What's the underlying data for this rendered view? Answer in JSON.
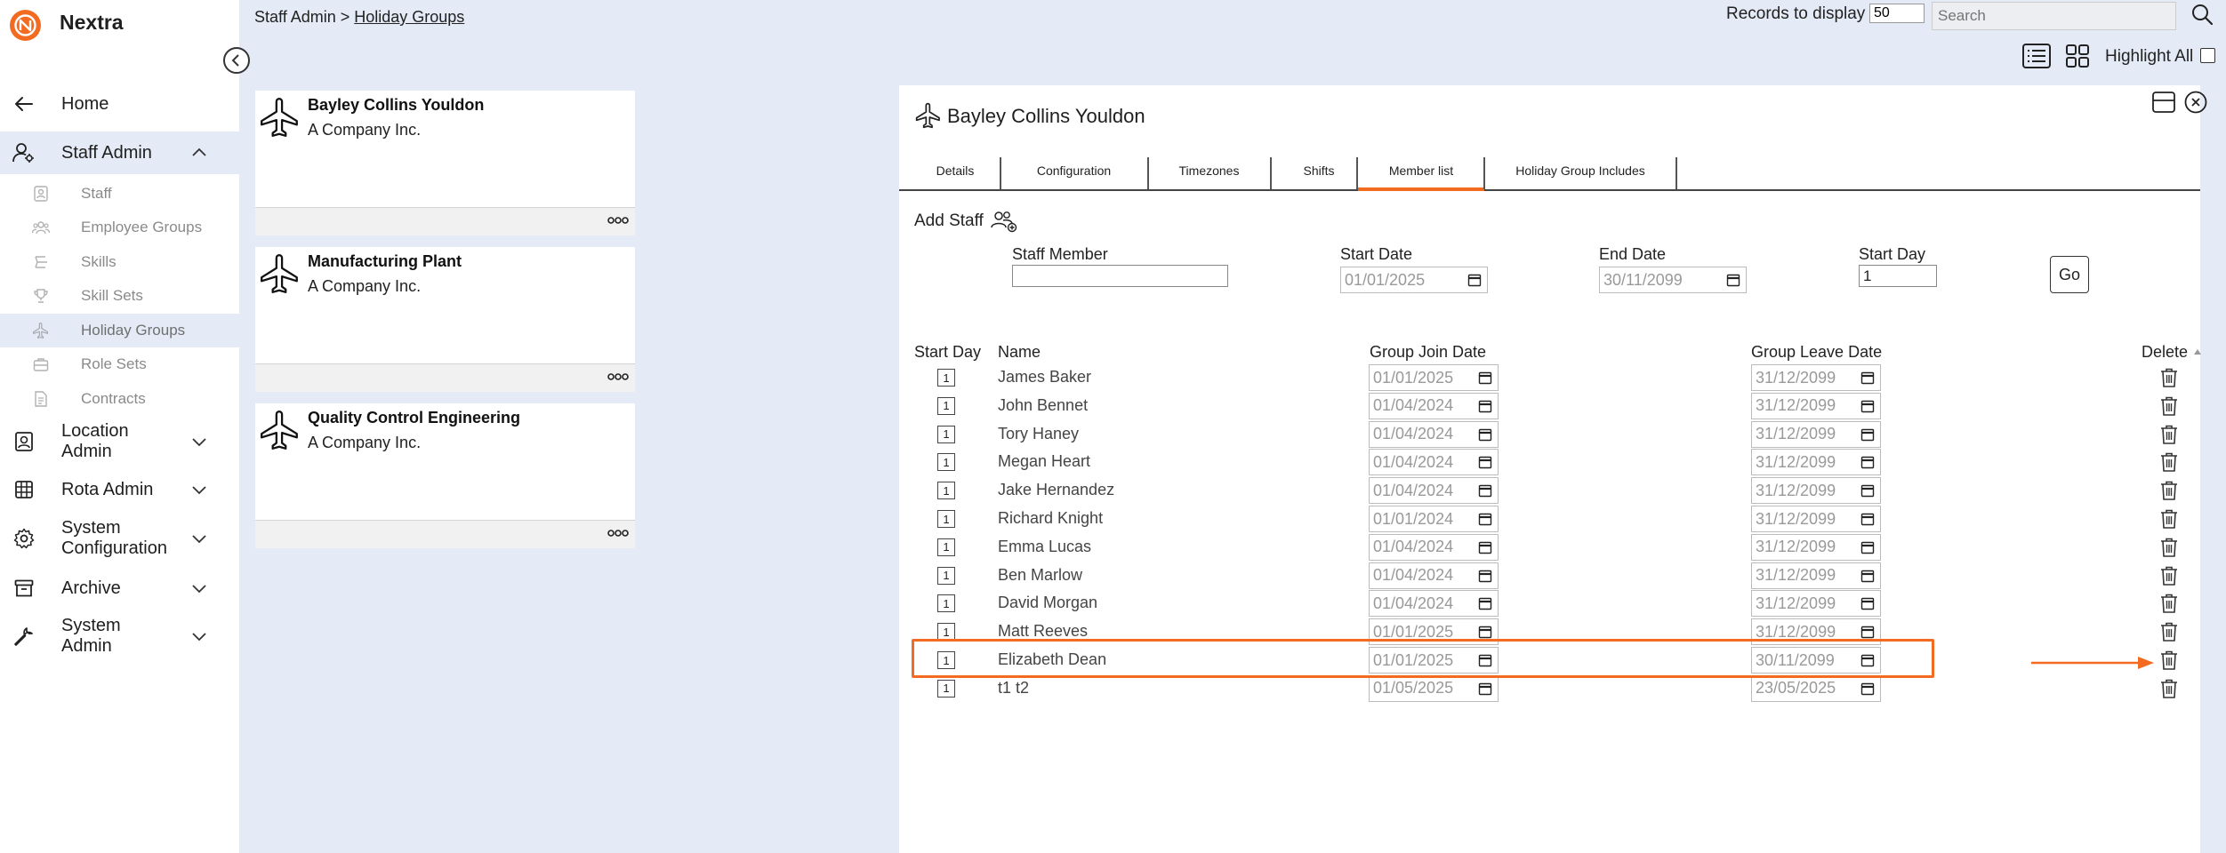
{
  "app": {
    "name": "Nextra"
  },
  "sidebar": {
    "home": "Home",
    "staff_admin": "Staff Admin",
    "sub_items": [
      "Staff",
      "Employee Groups",
      "Skills",
      "Skill Sets",
      "Holiday Groups",
      "Role Sets",
      "Contracts"
    ],
    "location_admin": "Location Admin",
    "rota_admin": "Rota Admin",
    "system_configuration": "System Configuration",
    "archive": "Archive",
    "system_admin": "System Admin"
  },
  "breadcrumb": {
    "parent": "Staff Admin",
    "sep": " > ",
    "current": "Holiday Groups"
  },
  "toolbar": {
    "records_label": "Records to display",
    "records_value": "50",
    "search_placeholder": "Search",
    "highlight_all": "Highlight All"
  },
  "groups": [
    {
      "title": "Bayley Collins Youldon",
      "company": "A Company Inc."
    },
    {
      "title": "Manufacturing Plant",
      "company": "A Company Inc."
    },
    {
      "title": "Quality Control Engineering",
      "company": "A Company Inc."
    }
  ],
  "panel": {
    "title": "Bayley Collins Youldon",
    "tabs": [
      "Details",
      "Configuration",
      "Timezones",
      "Shifts",
      "Member list",
      "Holiday Group Includes"
    ],
    "active_tab": "Member list",
    "add_staff": "Add Staff",
    "form": {
      "staff_member_label": "Staff Member",
      "staff_member_value": "",
      "start_date_label": "Start Date",
      "start_date_value": "01/01/2025",
      "end_date_label": "End Date",
      "end_date_value": "30/11/2099",
      "start_day_label": "Start Day",
      "start_day_value": "1",
      "go": "Go"
    },
    "columns": {
      "start_day": "Start Day",
      "name": "Name",
      "join": "Group Join Date",
      "leave": "Group Leave Date",
      "delete": "Delete"
    },
    "members": [
      {
        "start_day": "1",
        "name": "James Baker",
        "join": "01/01/2025",
        "leave": "31/12/2099"
      },
      {
        "start_day": "1",
        "name": "John Bennet",
        "join": "01/04/2024",
        "leave": "31/12/2099"
      },
      {
        "start_day": "1",
        "name": "Tory Haney",
        "join": "01/04/2024",
        "leave": "31/12/2099"
      },
      {
        "start_day": "1",
        "name": "Megan Heart",
        "join": "01/04/2024",
        "leave": "31/12/2099"
      },
      {
        "start_day": "1",
        "name": "Jake Hernandez",
        "join": "01/04/2024",
        "leave": "31/12/2099"
      },
      {
        "start_day": "1",
        "name": "Richard Knight",
        "join": "01/01/2024",
        "leave": "31/12/2099"
      },
      {
        "start_day": "1",
        "name": "Emma Lucas",
        "join": "01/04/2024",
        "leave": "31/12/2099"
      },
      {
        "start_day": "1",
        "name": "Ben Marlow",
        "join": "01/04/2024",
        "leave": "31/12/2099"
      },
      {
        "start_day": "1",
        "name": "David Morgan",
        "join": "01/04/2024",
        "leave": "31/12/2099"
      },
      {
        "start_day": "1",
        "name": "Matt Reeves",
        "join": "01/01/2025",
        "leave": "31/12/2099"
      },
      {
        "start_day": "1",
        "name": "Elizabeth Dean",
        "join": "01/01/2025",
        "leave": "30/11/2099"
      },
      {
        "start_day": "1",
        "name": "t1 t2",
        "join": "01/05/2025",
        "leave": "23/05/2025"
      }
    ]
  },
  "colors": {
    "accent": "#f26b21",
    "background": "#e4eaf6"
  }
}
